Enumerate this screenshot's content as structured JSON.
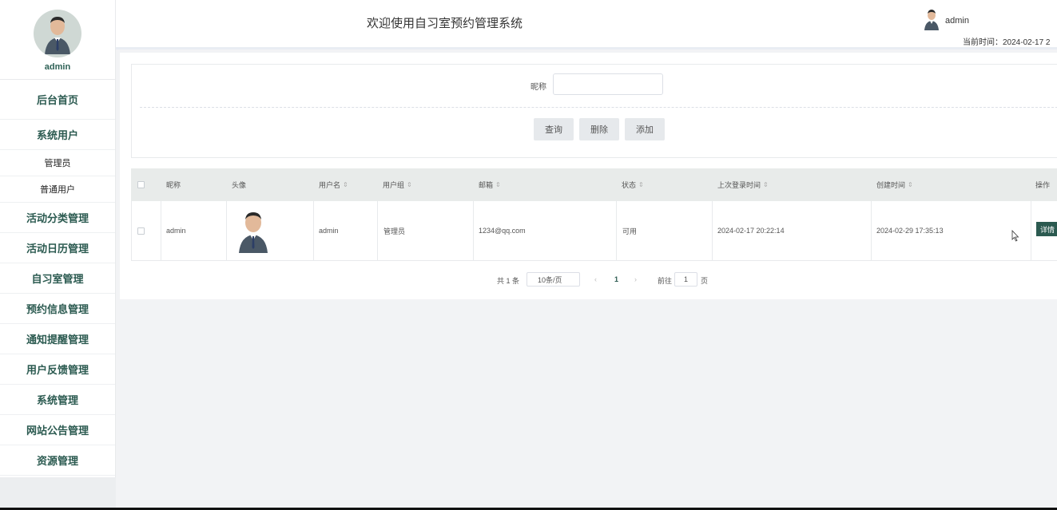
{
  "sidebar": {
    "profile_name": "admin",
    "items": [
      {
        "label": "后台首页"
      },
      {
        "label": "系统用户"
      },
      {
        "label": "管理员"
      },
      {
        "label": "普通用户"
      },
      {
        "label": "活动分类管理"
      },
      {
        "label": "活动日历管理"
      },
      {
        "label": "自习室管理"
      },
      {
        "label": "预约信息管理"
      },
      {
        "label": "通知提醒管理"
      },
      {
        "label": "用户反馈管理"
      },
      {
        "label": "系统管理"
      },
      {
        "label": "网站公告管理"
      },
      {
        "label": "资源管理"
      }
    ]
  },
  "header": {
    "title": "欢迎使用自习室预约管理系统",
    "user_name": "admin",
    "time_label": "当前时间：2024-02-17 2"
  },
  "search": {
    "label": "昵称",
    "value": "",
    "query_label": "查询",
    "delete_label": "删除",
    "add_label": "添加"
  },
  "table": {
    "headers": {
      "nickname": "昵称",
      "avatar": "头像",
      "username": "用户名",
      "group": "用户组",
      "email": "邮箱",
      "status": "状态",
      "last_login": "上次登录时间",
      "created": "创建时间",
      "actions": "操作"
    },
    "rows": [
      {
        "nickname": "admin",
        "username": "admin",
        "group": "管理员",
        "email": "1234@qq.com",
        "status": "可用",
        "last_login": "2024-02-17 20:22:14",
        "created": "2024-02-29 17:35:13",
        "action_label": "详情"
      }
    ]
  },
  "pagination": {
    "total": "共 1 条",
    "page_size": "10条/页",
    "current_page": "1",
    "goto_label": "前往",
    "goto_value": "1",
    "page_suffix": "页"
  },
  "colors": {
    "accent": "#2b5a50",
    "header_bg": "#e8ebea"
  }
}
